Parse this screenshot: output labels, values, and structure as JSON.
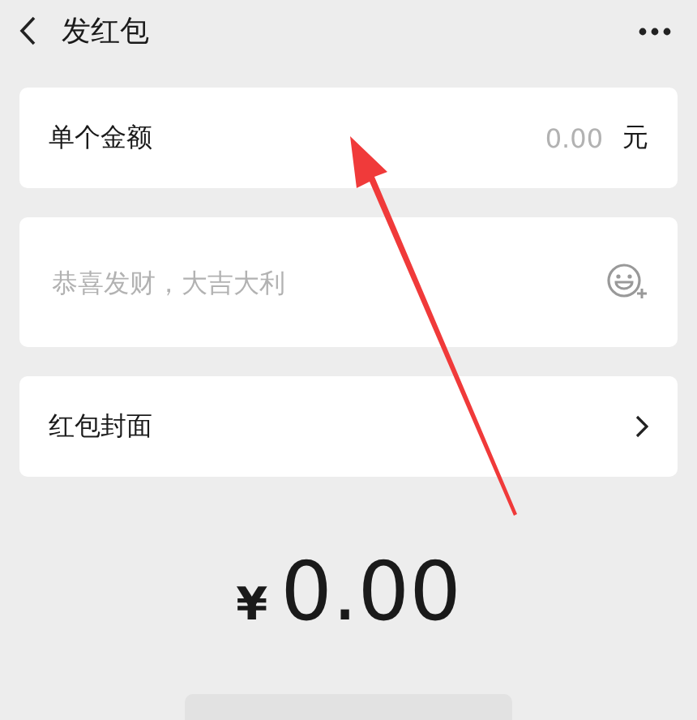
{
  "header": {
    "title": "发红包"
  },
  "amount_field": {
    "label": "单个金额",
    "placeholder": "0.00",
    "unit": "元"
  },
  "greeting_field": {
    "placeholder": "恭喜发财，大吉大利"
  },
  "cover_row": {
    "label": "红包封面"
  },
  "total": {
    "currency": "¥",
    "amount": "0.00"
  }
}
